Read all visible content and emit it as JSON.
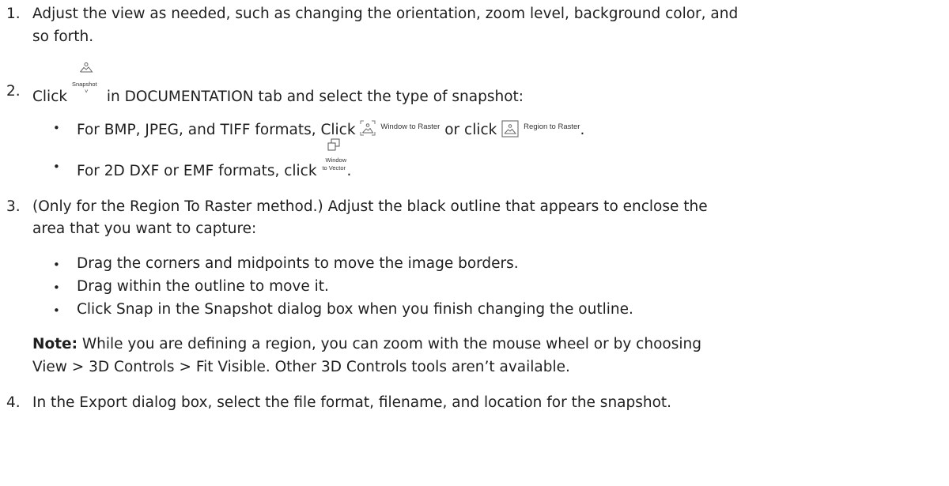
{
  "steps": [
    {
      "number": "1.",
      "line1": "Adjust the view as needed, such as changing the orientation, zoom level, background color, and",
      "line2": "so forth."
    },
    {
      "number": "2.",
      "pre": "Click",
      "icon_label": "Snapshot",
      "post": "in DOCUMENTATION tab and select the type of snapshot:"
    },
    {
      "number": "3.",
      "line1": "(Only for the Region To Raster method.) Adjust the black outline that appears to enclose the",
      "line2": "area that you want to capture:"
    },
    {
      "number": "4.",
      "line1": "In the Export dialog box, select the file format, filename, and location for the snapshot."
    }
  ],
  "step2_bullets": [
    {
      "pre": "For BMP, JPEG, and TIFF formats, Click",
      "icon1_label": "Window to Raster",
      "mid": "or click",
      "icon2_label": "Region to Raster",
      "post": "."
    },
    {
      "pre": "For 2D DXF or EMF formats, click",
      "icon_label_top": "Window",
      "icon_label_bottom": "to Vector",
      "post": "."
    }
  ],
  "step3_bullets": [
    "Drag the corners and midpoints to move the image borders.",
    "Drag within the outline to move it.",
    "Click Snap in the Snapshot dialog box when you finish changing the outline."
  ],
  "note": {
    "label": "Note:",
    "line1": "While you are defining a region, you can zoom with the mouse wheel or by choosing",
    "line2": "View > 3D Controls > Fit Visible. Other 3D Controls tools aren’t available."
  },
  "bullet_char": "•",
  "icons": [
    "snapshot-icon",
    "window-to-raster-icon",
    "region-to-raster-icon",
    "window-to-vector-icon"
  ]
}
